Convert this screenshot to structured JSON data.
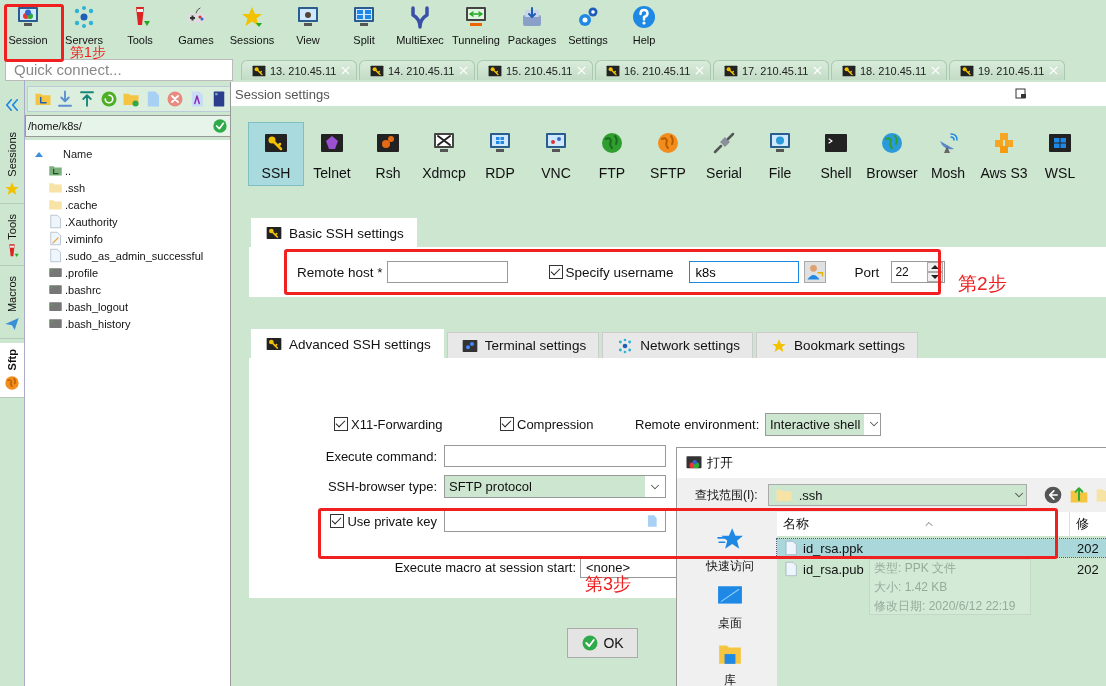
{
  "toolbar": [
    {
      "label": "Session",
      "kind": "session"
    },
    {
      "label": "Servers",
      "kind": "servers"
    },
    {
      "label": "Tools",
      "kind": "tools"
    },
    {
      "label": "Games",
      "kind": "games"
    },
    {
      "label": "Sessions",
      "kind": "sessions"
    },
    {
      "label": "View",
      "kind": "view"
    },
    {
      "label": "Split",
      "kind": "split"
    },
    {
      "label": "MultiExec",
      "kind": "multiexec"
    },
    {
      "label": "Tunneling",
      "kind": "tunneling"
    },
    {
      "label": "Packages",
      "kind": "packages"
    },
    {
      "label": "Settings",
      "kind": "settings"
    },
    {
      "label": "Help",
      "kind": "help"
    }
  ],
  "quick_connect": {
    "placeholder": "Quick connect..."
  },
  "session_tabs": [
    {
      "label": "13. 210.45.11"
    },
    {
      "label": "14. 210.45.11"
    },
    {
      "label": "15. 210.45.11"
    },
    {
      "label": "16. 210.45.11"
    },
    {
      "label": "17. 210.45.11"
    },
    {
      "label": "18. 210.45.11"
    },
    {
      "label": "19. 210.45.11"
    }
  ],
  "side_tabs": [
    {
      "label": "Sessions",
      "kind": "star",
      "selected": false
    },
    {
      "label": "Tools",
      "kind": "tools",
      "selected": false
    },
    {
      "label": "Macros",
      "kind": "plane",
      "selected": false
    },
    {
      "label": "Sftp",
      "kind": "sftp",
      "selected": true
    }
  ],
  "file_browser": {
    "path": "/home/k8s/",
    "column": "Name",
    "files": [
      {
        "name": "..",
        "kind": "parent"
      },
      {
        "name": ".ssh",
        "kind": "folder"
      },
      {
        "name": ".cache",
        "kind": "folder"
      },
      {
        "name": ".Xauthority",
        "kind": "doc"
      },
      {
        "name": ".viminfo",
        "kind": "edit"
      },
      {
        "name": ".sudo_as_admin_successful",
        "kind": "doc"
      },
      {
        "name": ".profile",
        "kind": "script"
      },
      {
        "name": ".bashrc",
        "kind": "script"
      },
      {
        "name": ".bash_logout",
        "kind": "script"
      },
      {
        "name": ".bash_history",
        "kind": "script"
      }
    ]
  },
  "session_dialog": {
    "title": "Session settings",
    "protocols": [
      {
        "label": "SSH",
        "kind": "key",
        "selected": true
      },
      {
        "label": "Telnet",
        "kind": "telnet",
        "selected": false
      },
      {
        "label": "Rsh",
        "kind": "rsh",
        "selected": false
      },
      {
        "label": "Xdmcp",
        "kind": "xdmcp",
        "selected": false
      },
      {
        "label": "RDP",
        "kind": "rdp",
        "selected": false
      },
      {
        "label": "VNC",
        "kind": "vnc",
        "selected": false
      },
      {
        "label": "FTP",
        "kind": "ftp",
        "selected": false
      },
      {
        "label": "SFTP",
        "kind": "sftp",
        "selected": false
      },
      {
        "label": "Serial",
        "kind": "serial",
        "selected": false
      },
      {
        "label": "File",
        "kind": "file",
        "selected": false
      },
      {
        "label": "Shell",
        "kind": "shell",
        "selected": false
      },
      {
        "label": "Browser",
        "kind": "browser",
        "selected": false
      },
      {
        "label": "Mosh",
        "kind": "mosh",
        "selected": false
      },
      {
        "label": "Aws S3",
        "kind": "awss3",
        "selected": false
      },
      {
        "label": "WSL",
        "kind": "wsl",
        "selected": false
      }
    ],
    "basic_tab": "Basic SSH settings",
    "remote_host": {
      "label": "Remote host *"
    },
    "specify_username": {
      "label": "Specify username",
      "checked": true,
      "value": "k8s"
    },
    "port": {
      "label": "Port",
      "value": "22"
    },
    "advanced_tabs": [
      {
        "label": "Advanced SSH settings",
        "kind": "key",
        "selected": true
      },
      {
        "label": "Terminal settings",
        "kind": "terminal",
        "selected": false
      },
      {
        "label": "Network settings",
        "kind": "servers",
        "selected": false
      },
      {
        "label": "Bookmark settings",
        "kind": "star",
        "selected": false
      }
    ],
    "x11_forwarding": {
      "label": "X11-Forwarding",
      "checked": true
    },
    "compression": {
      "label": "Compression",
      "checked": true
    },
    "remote_environment": {
      "label": "Remote environment:",
      "value": "Interactive shell"
    },
    "execute_command": {
      "label": "Execute command:"
    },
    "ssh_browser_type": {
      "label": "SSH-browser type:",
      "value": "SFTP protocol"
    },
    "use_private_key": {
      "label": "Use private key",
      "checked": true
    },
    "execute_macro": {
      "label": "Execute macro at session start:",
      "value": "<none>"
    },
    "ok_button": "OK"
  },
  "open_dialog": {
    "title": "打开",
    "look_in": {
      "label": "查找范围(I):",
      "value": ".ssh"
    },
    "places": [
      {
        "label": "快速访问",
        "kind": "quick"
      },
      {
        "label": "桌面",
        "kind": "desktop"
      },
      {
        "label": "库",
        "kind": "library"
      }
    ],
    "columns": [
      "名称",
      "修"
    ],
    "files": [
      {
        "name": "id_rsa.ppk",
        "date": "202",
        "selected": true
      },
      {
        "name": "id_rsa.pub",
        "date": "202",
        "selected": false
      }
    ],
    "tooltip": [
      "类型: PPK 文件",
      "大小: 1.42 KB",
      "修改日期: 2020/6/12 22:19"
    ]
  },
  "step_labels": [
    "第1步",
    "第2步",
    "第3步"
  ]
}
